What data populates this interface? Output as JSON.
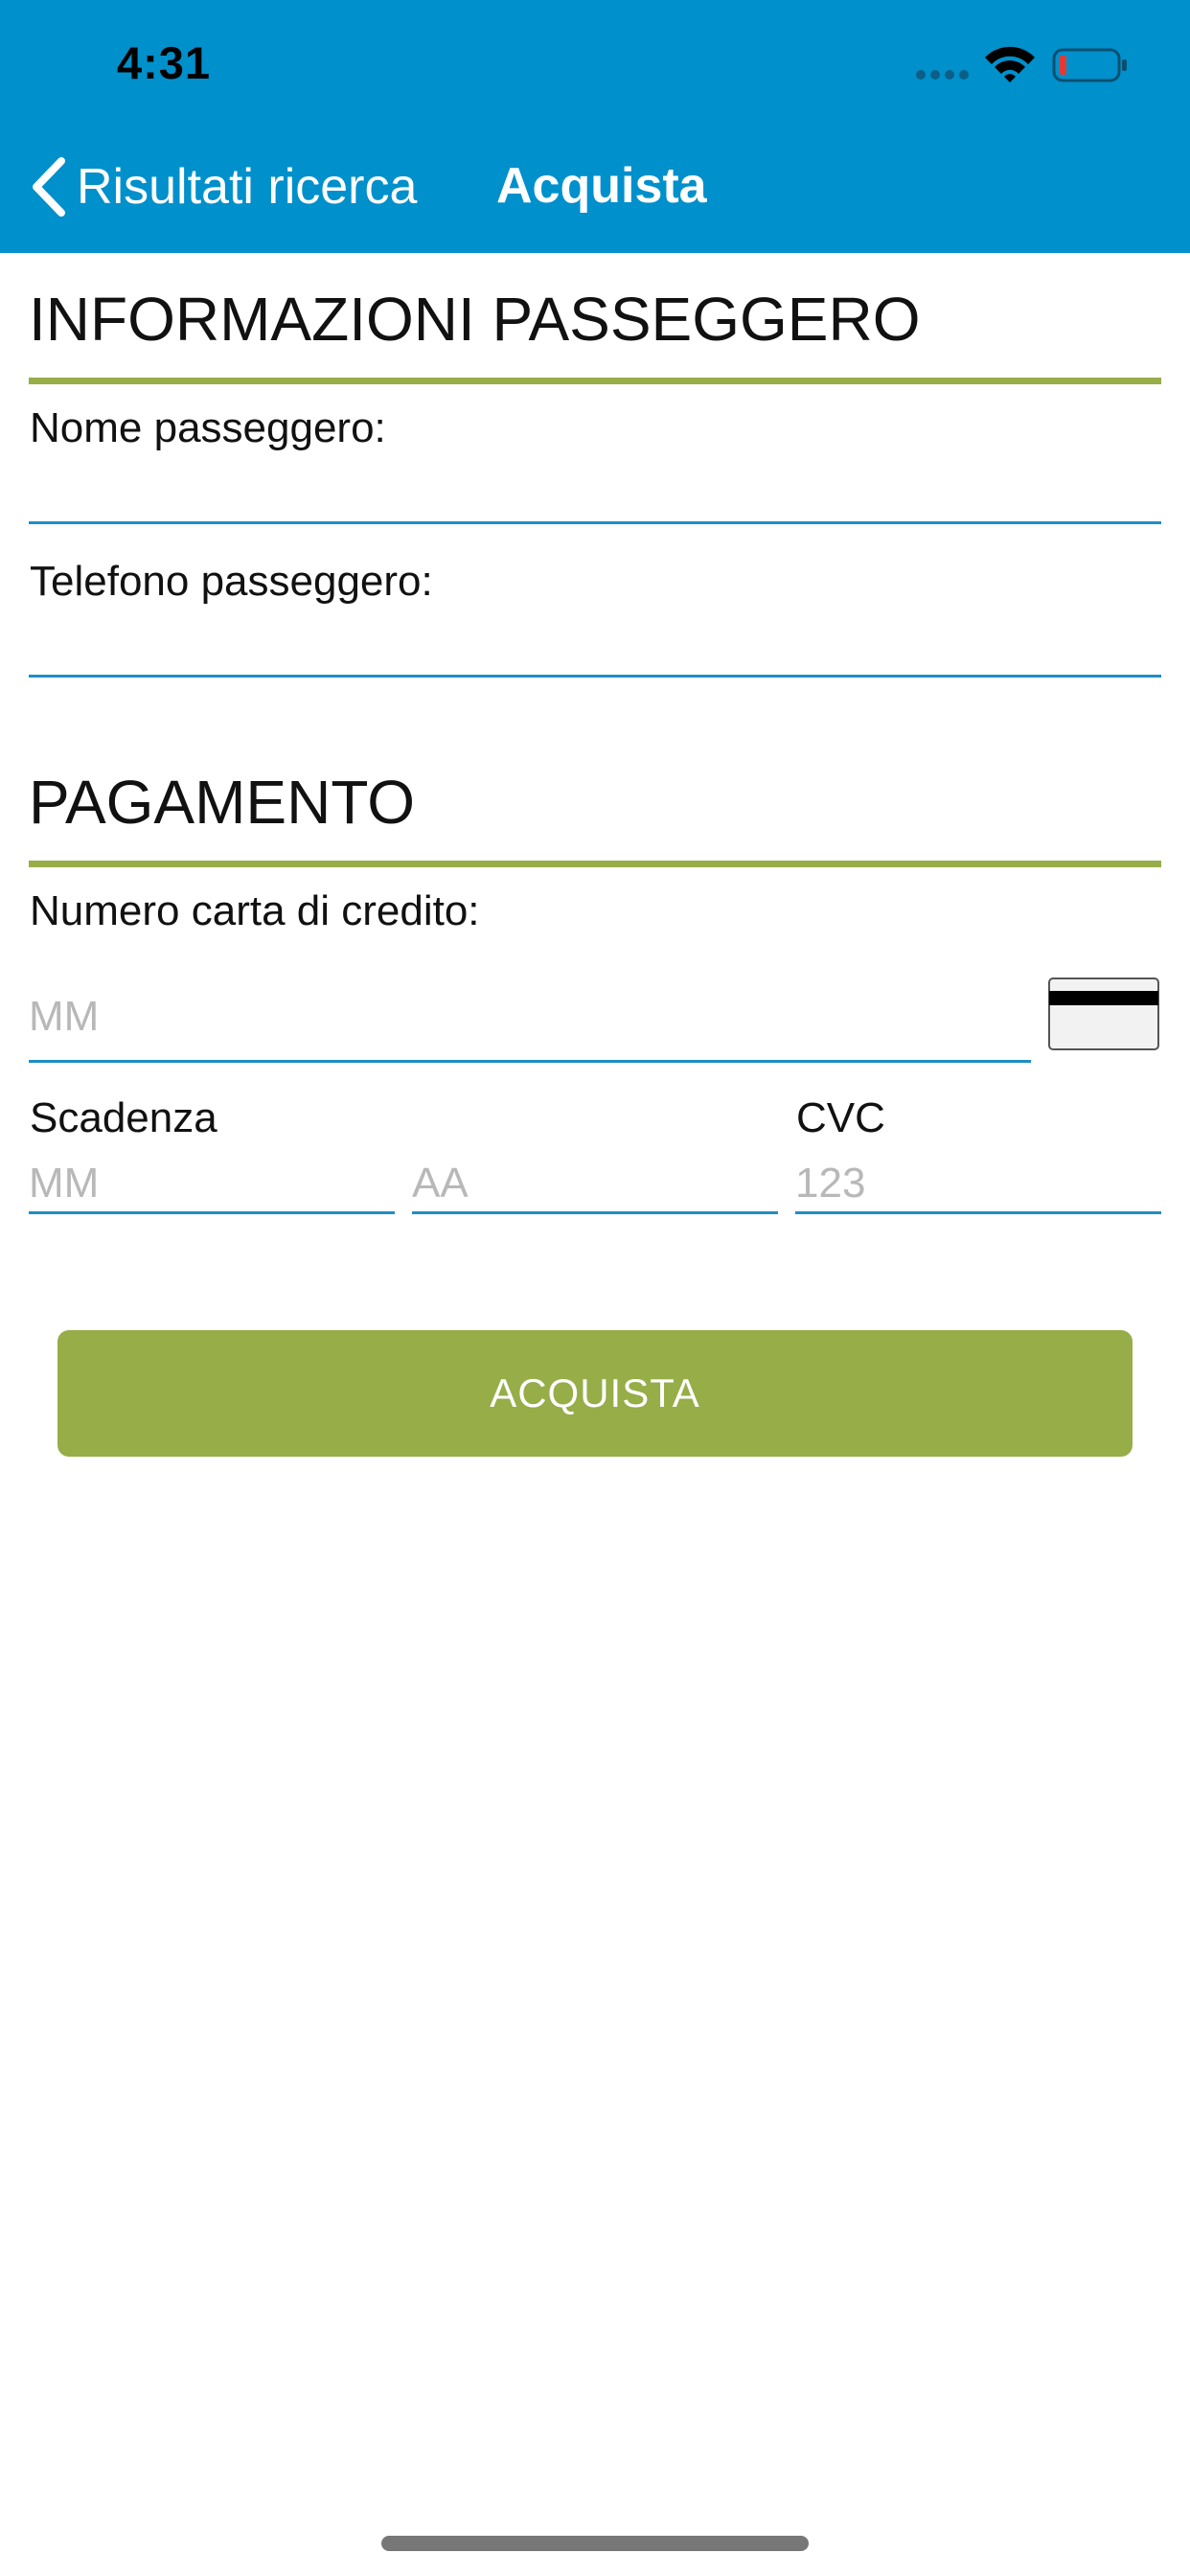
{
  "status_bar": {
    "time": "4:31"
  },
  "nav": {
    "back_label": "Risultati ricerca",
    "title": "Acquista"
  },
  "passenger": {
    "section_title": "INFORMAZIONI PASSEGGERO",
    "name_label": "Nome passeggero:",
    "name_value": "",
    "phone_label": "Telefono passeggero:",
    "phone_value": ""
  },
  "payment": {
    "section_title": "PAGAMENTO",
    "card_label": "Numero carta di credito:",
    "card_placeholder": "MM",
    "expiry_label": "Scadenza",
    "month_placeholder": "MM",
    "year_placeholder": "AA",
    "cvc_label": "CVC",
    "cvc_placeholder": "123"
  },
  "buy_button": {
    "label": "ACQUISTA"
  },
  "colors": {
    "header": "#0090cb",
    "accent_green": "#96ad48",
    "input_underline": "#1e8ec6",
    "placeholder": "#b8b8b8"
  },
  "icons": {
    "back": "chevron-left-icon",
    "wifi": "wifi-icon",
    "battery": "battery-icon",
    "card": "credit-card-icon"
  }
}
